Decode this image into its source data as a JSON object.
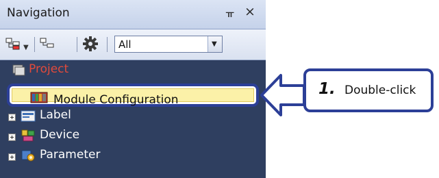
{
  "panel": {
    "title": "Navigation",
    "pin_glyph": "ᚂ",
    "close_glyph": "×"
  },
  "toolbar": {
    "filter_value": "All",
    "icons": [
      "tree-expand-icon",
      "tree-collapse-icon",
      "gear-icon",
      "chevron-down-icon"
    ]
  },
  "tree": {
    "root_label": "Project",
    "selected_label": "Module Configuration",
    "items": [
      {
        "label": "Label",
        "icon": "label-icon"
      },
      {
        "label": "Device",
        "icon": "device-icon"
      },
      {
        "label": "Parameter",
        "icon": "parameter-icon"
      }
    ]
  },
  "callout": {
    "step_number": "1.",
    "instruction": "Double-click"
  },
  "colors": {
    "panel_bg": "#2f3f60",
    "highlight_border": "#2c3f97",
    "selected_bg": "#fbf1a8"
  }
}
